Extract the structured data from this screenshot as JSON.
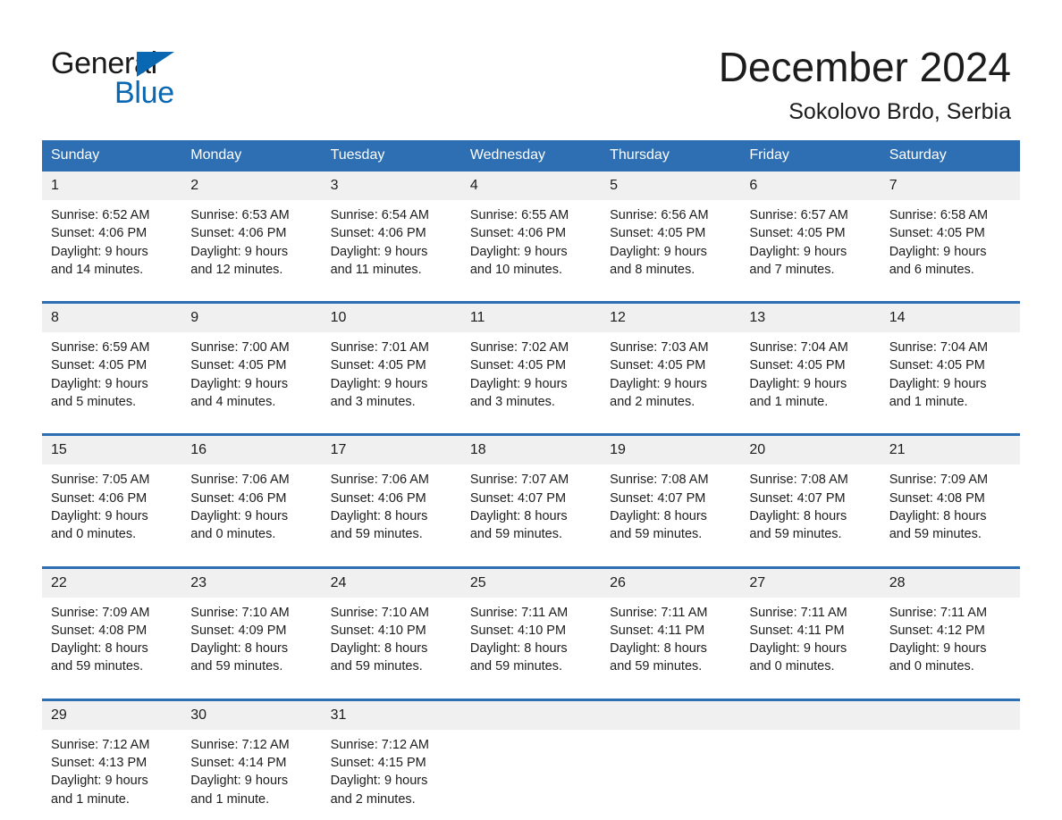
{
  "logo": {
    "word_one": "General",
    "word_two": "Blue",
    "triangle_icon": "triangle-icon",
    "accent_color": "#0a67b2"
  },
  "header": {
    "title": "December 2024",
    "subtitle": "Sokolovo Brdo, Serbia"
  },
  "theme": {
    "header_blue": "#2d6fb2",
    "date_strip_gray": "#f0f0f0",
    "text_black": "#1c1c1c"
  },
  "calendar": {
    "weekdays": [
      "Sunday",
      "Monday",
      "Tuesday",
      "Wednesday",
      "Thursday",
      "Friday",
      "Saturday"
    ],
    "weeks": [
      [
        {
          "day": "1",
          "sunrise": "Sunrise: 6:52 AM",
          "sunset": "Sunset: 4:06 PM",
          "daylight_line1": "Daylight: 9 hours",
          "daylight_line2": "and 14 minutes."
        },
        {
          "day": "2",
          "sunrise": "Sunrise: 6:53 AM",
          "sunset": "Sunset: 4:06 PM",
          "daylight_line1": "Daylight: 9 hours",
          "daylight_line2": "and 12 minutes."
        },
        {
          "day": "3",
          "sunrise": "Sunrise: 6:54 AM",
          "sunset": "Sunset: 4:06 PM",
          "daylight_line1": "Daylight: 9 hours",
          "daylight_line2": "and 11 minutes."
        },
        {
          "day": "4",
          "sunrise": "Sunrise: 6:55 AM",
          "sunset": "Sunset: 4:06 PM",
          "daylight_line1": "Daylight: 9 hours",
          "daylight_line2": "and 10 minutes."
        },
        {
          "day": "5",
          "sunrise": "Sunrise: 6:56 AM",
          "sunset": "Sunset: 4:05 PM",
          "daylight_line1": "Daylight: 9 hours",
          "daylight_line2": "and 8 minutes."
        },
        {
          "day": "6",
          "sunrise": "Sunrise: 6:57 AM",
          "sunset": "Sunset: 4:05 PM",
          "daylight_line1": "Daylight: 9 hours",
          "daylight_line2": "and 7 minutes."
        },
        {
          "day": "7",
          "sunrise": "Sunrise: 6:58 AM",
          "sunset": "Sunset: 4:05 PM",
          "daylight_line1": "Daylight: 9 hours",
          "daylight_line2": "and 6 minutes."
        }
      ],
      [
        {
          "day": "8",
          "sunrise": "Sunrise: 6:59 AM",
          "sunset": "Sunset: 4:05 PM",
          "daylight_line1": "Daylight: 9 hours",
          "daylight_line2": "and 5 minutes."
        },
        {
          "day": "9",
          "sunrise": "Sunrise: 7:00 AM",
          "sunset": "Sunset: 4:05 PM",
          "daylight_line1": "Daylight: 9 hours",
          "daylight_line2": "and 4 minutes."
        },
        {
          "day": "10",
          "sunrise": "Sunrise: 7:01 AM",
          "sunset": "Sunset: 4:05 PM",
          "daylight_line1": "Daylight: 9 hours",
          "daylight_line2": "and 3 minutes."
        },
        {
          "day": "11",
          "sunrise": "Sunrise: 7:02 AM",
          "sunset": "Sunset: 4:05 PM",
          "daylight_line1": "Daylight: 9 hours",
          "daylight_line2": "and 3 minutes."
        },
        {
          "day": "12",
          "sunrise": "Sunrise: 7:03 AM",
          "sunset": "Sunset: 4:05 PM",
          "daylight_line1": "Daylight: 9 hours",
          "daylight_line2": "and 2 minutes."
        },
        {
          "day": "13",
          "sunrise": "Sunrise: 7:04 AM",
          "sunset": "Sunset: 4:05 PM",
          "daylight_line1": "Daylight: 9 hours",
          "daylight_line2": "and 1 minute."
        },
        {
          "day": "14",
          "sunrise": "Sunrise: 7:04 AM",
          "sunset": "Sunset: 4:05 PM",
          "daylight_line1": "Daylight: 9 hours",
          "daylight_line2": "and 1 minute."
        }
      ],
      [
        {
          "day": "15",
          "sunrise": "Sunrise: 7:05 AM",
          "sunset": "Sunset: 4:06 PM",
          "daylight_line1": "Daylight: 9 hours",
          "daylight_line2": "and 0 minutes."
        },
        {
          "day": "16",
          "sunrise": "Sunrise: 7:06 AM",
          "sunset": "Sunset: 4:06 PM",
          "daylight_line1": "Daylight: 9 hours",
          "daylight_line2": "and 0 minutes."
        },
        {
          "day": "17",
          "sunrise": "Sunrise: 7:06 AM",
          "sunset": "Sunset: 4:06 PM",
          "daylight_line1": "Daylight: 8 hours",
          "daylight_line2": "and 59 minutes."
        },
        {
          "day": "18",
          "sunrise": "Sunrise: 7:07 AM",
          "sunset": "Sunset: 4:07 PM",
          "daylight_line1": "Daylight: 8 hours",
          "daylight_line2": "and 59 minutes."
        },
        {
          "day": "19",
          "sunrise": "Sunrise: 7:08 AM",
          "sunset": "Sunset: 4:07 PM",
          "daylight_line1": "Daylight: 8 hours",
          "daylight_line2": "and 59 minutes."
        },
        {
          "day": "20",
          "sunrise": "Sunrise: 7:08 AM",
          "sunset": "Sunset: 4:07 PM",
          "daylight_line1": "Daylight: 8 hours",
          "daylight_line2": "and 59 minutes."
        },
        {
          "day": "21",
          "sunrise": "Sunrise: 7:09 AM",
          "sunset": "Sunset: 4:08 PM",
          "daylight_line1": "Daylight: 8 hours",
          "daylight_line2": "and 59 minutes."
        }
      ],
      [
        {
          "day": "22",
          "sunrise": "Sunrise: 7:09 AM",
          "sunset": "Sunset: 4:08 PM",
          "daylight_line1": "Daylight: 8 hours",
          "daylight_line2": "and 59 minutes."
        },
        {
          "day": "23",
          "sunrise": "Sunrise: 7:10 AM",
          "sunset": "Sunset: 4:09 PM",
          "daylight_line1": "Daylight: 8 hours",
          "daylight_line2": "and 59 minutes."
        },
        {
          "day": "24",
          "sunrise": "Sunrise: 7:10 AM",
          "sunset": "Sunset: 4:10 PM",
          "daylight_line1": "Daylight: 8 hours",
          "daylight_line2": "and 59 minutes."
        },
        {
          "day": "25",
          "sunrise": "Sunrise: 7:11 AM",
          "sunset": "Sunset: 4:10 PM",
          "daylight_line1": "Daylight: 8 hours",
          "daylight_line2": "and 59 minutes."
        },
        {
          "day": "26",
          "sunrise": "Sunrise: 7:11 AM",
          "sunset": "Sunset: 4:11 PM",
          "daylight_line1": "Daylight: 8 hours",
          "daylight_line2": "and 59 minutes."
        },
        {
          "day": "27",
          "sunrise": "Sunrise: 7:11 AM",
          "sunset": "Sunset: 4:11 PM",
          "daylight_line1": "Daylight: 9 hours",
          "daylight_line2": "and 0 minutes."
        },
        {
          "day": "28",
          "sunrise": "Sunrise: 7:11 AM",
          "sunset": "Sunset: 4:12 PM",
          "daylight_line1": "Daylight: 9 hours",
          "daylight_line2": "and 0 minutes."
        }
      ],
      [
        {
          "day": "29",
          "sunrise": "Sunrise: 7:12 AM",
          "sunset": "Sunset: 4:13 PM",
          "daylight_line1": "Daylight: 9 hours",
          "daylight_line2": "and 1 minute."
        },
        {
          "day": "30",
          "sunrise": "Sunrise: 7:12 AM",
          "sunset": "Sunset: 4:14 PM",
          "daylight_line1": "Daylight: 9 hours",
          "daylight_line2": "and 1 minute."
        },
        {
          "day": "31",
          "sunrise": "Sunrise: 7:12 AM",
          "sunset": "Sunset: 4:15 PM",
          "daylight_line1": "Daylight: 9 hours",
          "daylight_line2": "and 2 minutes."
        },
        {
          "day": "",
          "sunrise": "",
          "sunset": "",
          "daylight_line1": "",
          "daylight_line2": ""
        },
        {
          "day": "",
          "sunrise": "",
          "sunset": "",
          "daylight_line1": "",
          "daylight_line2": ""
        },
        {
          "day": "",
          "sunrise": "",
          "sunset": "",
          "daylight_line1": "",
          "daylight_line2": ""
        },
        {
          "day": "",
          "sunrise": "",
          "sunset": "",
          "daylight_line1": "",
          "daylight_line2": ""
        }
      ]
    ]
  }
}
